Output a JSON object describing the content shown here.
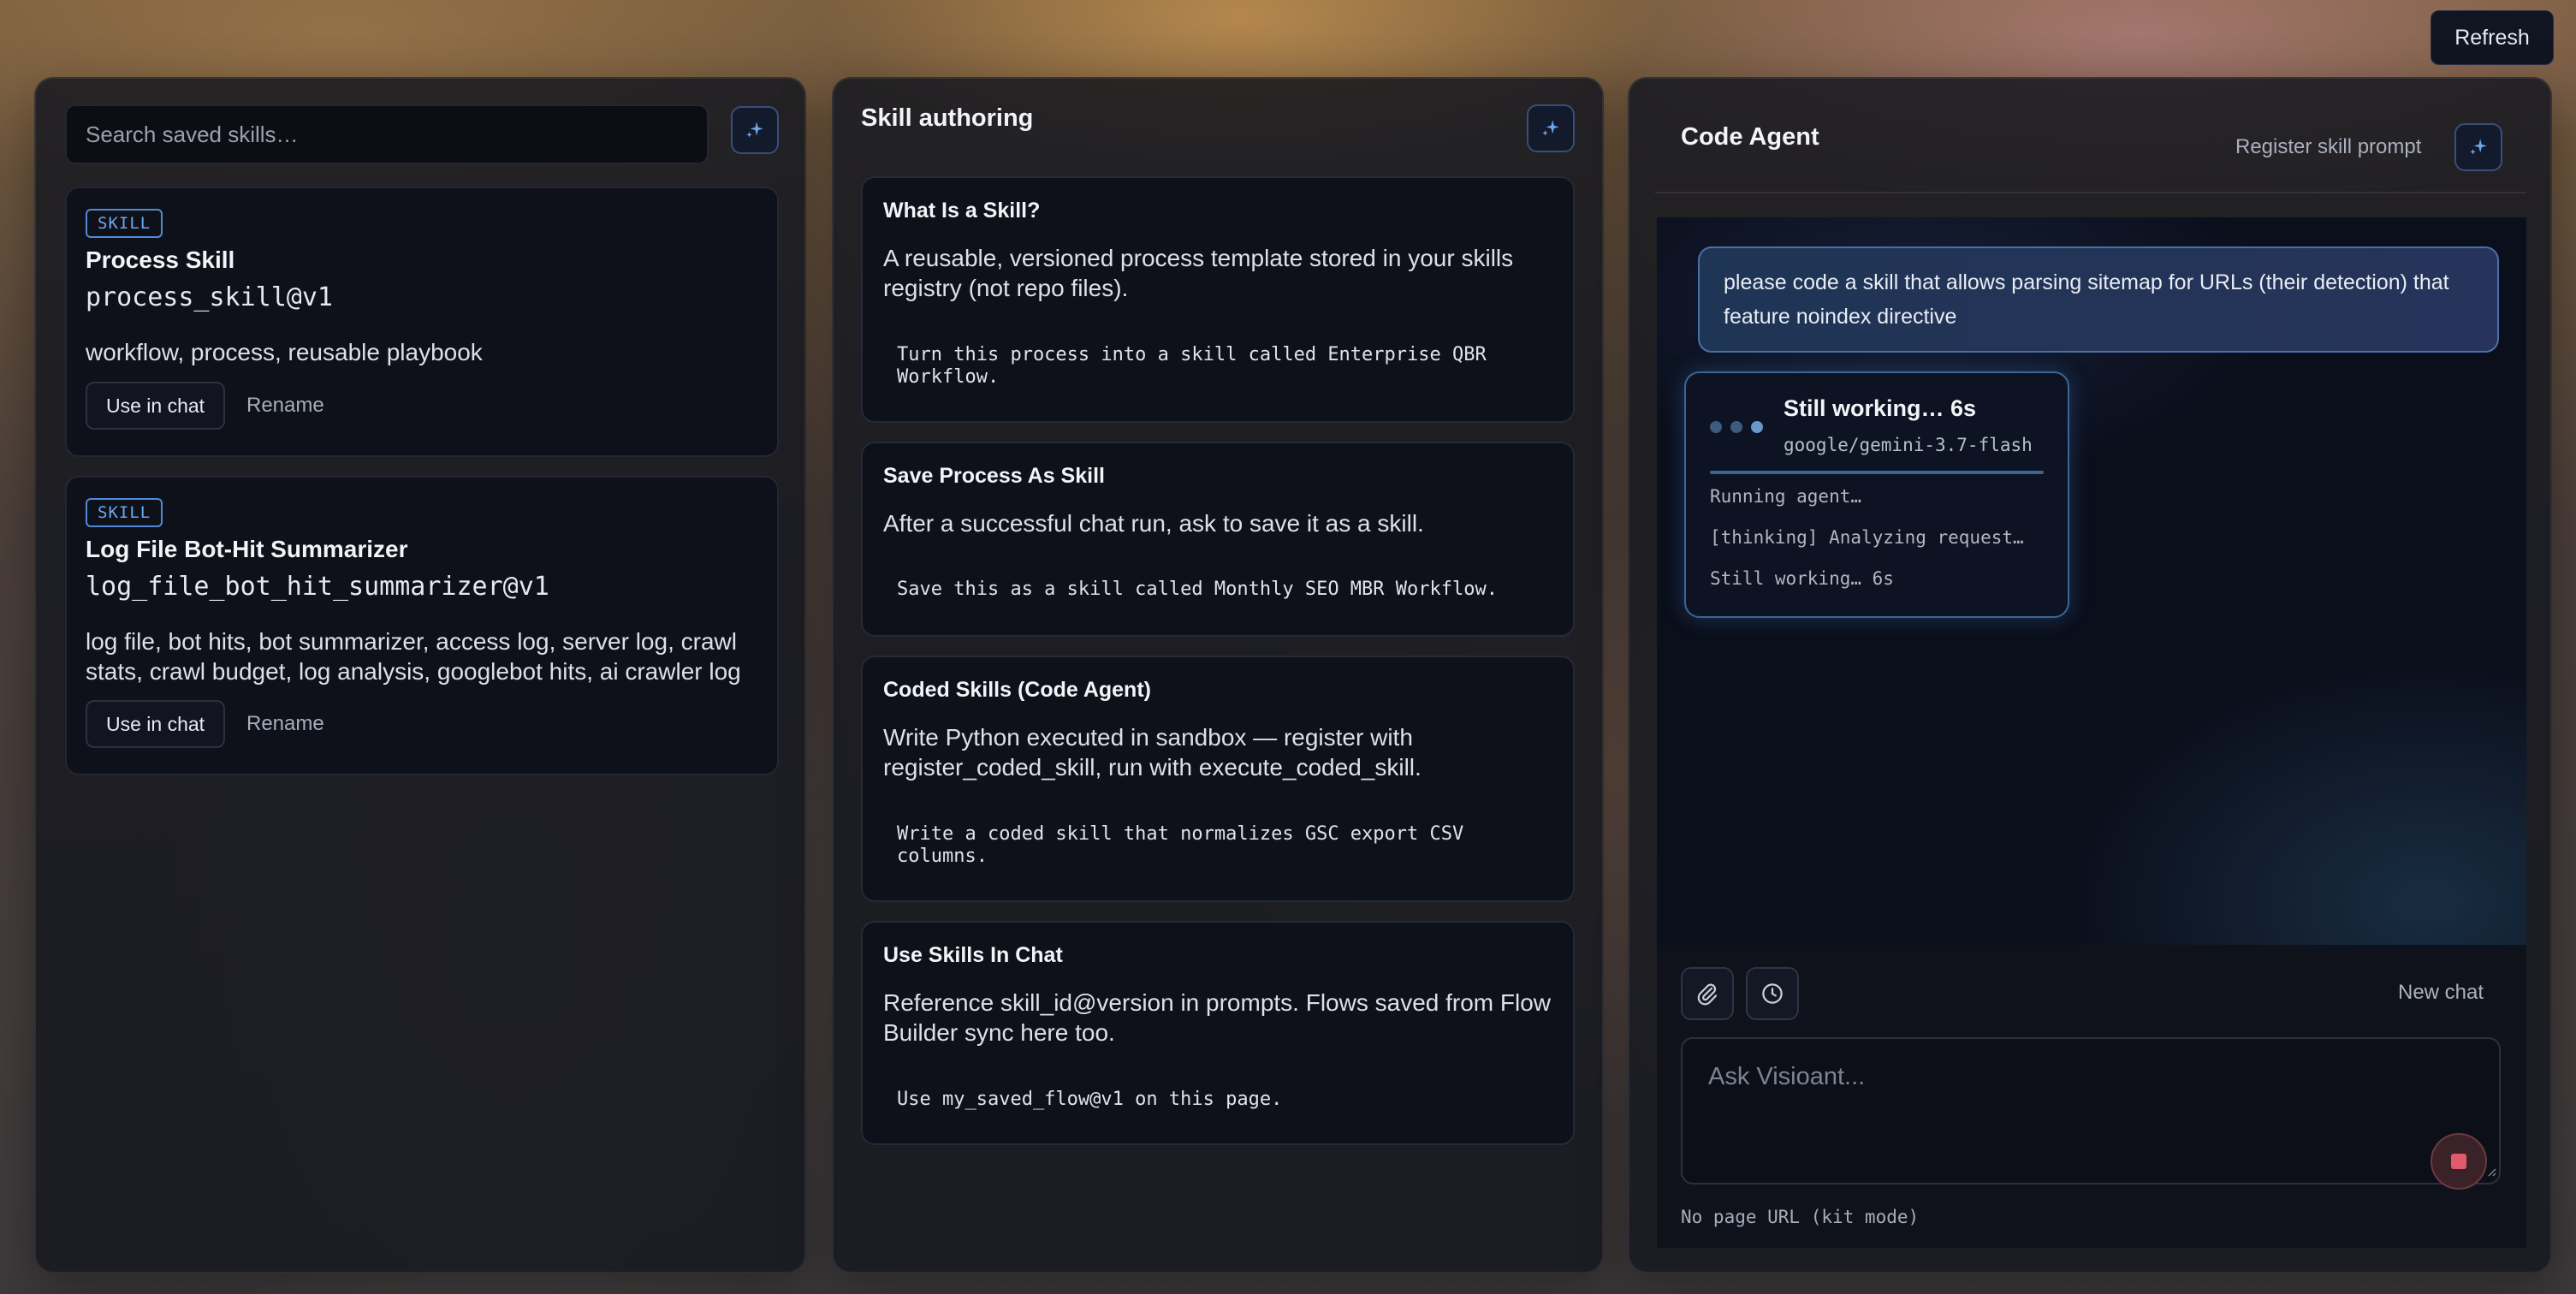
{
  "header": {
    "refresh_label": "Refresh"
  },
  "skills_panel": {
    "search_placeholder": "Search saved skills…",
    "skills": [
      {
        "badge": "SKILL",
        "name": "Process Skill",
        "id": "process_skill@v1",
        "tags": "workflow, process, reusable playbook",
        "use_label": "Use in chat",
        "rename_label": "Rename"
      },
      {
        "badge": "SKILL",
        "name": "Log File Bot-Hit Summarizer",
        "id": "log_file_bot_hit_summarizer@v1",
        "tags": "log file, bot hits, bot summarizer, access log, server log, crawl stats, crawl budget, log analysis, googlebot hits, ai crawler log",
        "use_label": "Use in chat",
        "rename_label": "Rename"
      }
    ]
  },
  "authoring_panel": {
    "title": "Skill authoring",
    "cards": [
      {
        "title": "What Is a Skill?",
        "description": "A reusable, versioned process template stored in your skills registry (not repo files).",
        "example": "Turn this process into a skill called Enterprise QBR Workflow."
      },
      {
        "title": "Save Process As Skill",
        "description": "After a successful chat run, ask to save it as a skill.",
        "example": "Save this as a skill called Monthly SEO MBR Workflow."
      },
      {
        "title": "Coded Skills (Code Agent)",
        "description": "Write Python executed in sandbox — register with register_coded_skill, run with execute_coded_skill.",
        "example": "Write a coded skill that normalizes GSC export CSV columns."
      },
      {
        "title": "Use Skills In Chat",
        "description": "Reference skill_id@version in prompts. Flows saved from Flow Builder sync here too.",
        "example": "Use my_saved_flow@v1 on this page."
      }
    ]
  },
  "agent_panel": {
    "title": "Code Agent",
    "register_label": "Register skill prompt",
    "user_message": "please code a skill that allows parsing sitemap for URLs (their detection) that feature noindex directive",
    "status": {
      "title": "Still working… 6s",
      "model": "google/gemini-3.7-flash",
      "log": [
        "Running agent…",
        "[thinking] Analyzing request…",
        "Still working… 6s"
      ]
    },
    "new_chat_label": "New chat",
    "input_placeholder": "Ask Visioant...",
    "page_url_note": "No page URL (kit mode)"
  },
  "colors": {
    "accent": "#4f8bd8",
    "panel_bg": "#16182a",
    "stop": "#e05a6a"
  },
  "icons": [
    "sparkle-icon",
    "paperclip-icon",
    "clock-icon",
    "stop-icon"
  ]
}
